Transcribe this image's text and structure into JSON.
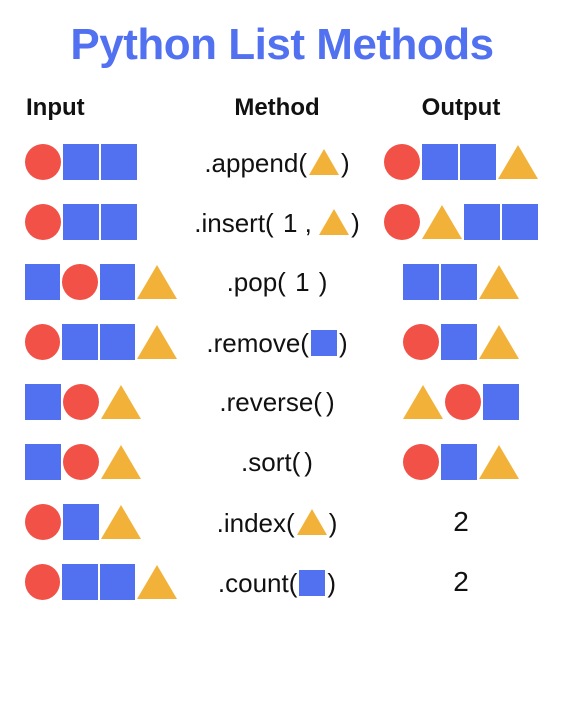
{
  "title": "Python List Methods",
  "headers": {
    "input": "Input",
    "method": "Method",
    "output": "Output"
  },
  "colors": {
    "blue": "#5171f0",
    "red": "#f15147",
    "orange": "#f2b239"
  },
  "rows": [
    {
      "input": [
        "circle",
        "square",
        "square"
      ],
      "method": {
        "name": ".append",
        "args": [
          {
            "type": "shape",
            "value": "triangle"
          }
        ]
      },
      "output": {
        "type": "shapes",
        "value": [
          "circle",
          "square",
          "square",
          "triangle"
        ]
      }
    },
    {
      "input": [
        "circle",
        "square",
        "square"
      ],
      "method": {
        "name": ".insert",
        "args": [
          {
            "type": "text",
            "value": "1"
          },
          {
            "type": "shape",
            "value": "triangle"
          }
        ]
      },
      "output": {
        "type": "shapes",
        "value": [
          "circle",
          "triangle",
          "square",
          "square"
        ]
      }
    },
    {
      "input": [
        "square",
        "circle",
        "square",
        "triangle"
      ],
      "method": {
        "name": ".pop",
        "args": [
          {
            "type": "text",
            "value": "1"
          }
        ]
      },
      "output": {
        "type": "shapes",
        "value": [
          "square",
          "square",
          "triangle"
        ]
      }
    },
    {
      "input": [
        "circle",
        "square",
        "square",
        "triangle"
      ],
      "method": {
        "name": ".remove",
        "args": [
          {
            "type": "shape",
            "value": "square"
          }
        ]
      },
      "output": {
        "type": "shapes",
        "value": [
          "circle",
          "square",
          "triangle"
        ]
      }
    },
    {
      "input": [
        "square",
        "circle",
        "triangle"
      ],
      "method": {
        "name": ".reverse",
        "args": []
      },
      "output": {
        "type": "shapes",
        "value": [
          "triangle",
          "circle",
          "square"
        ]
      }
    },
    {
      "input": [
        "square",
        "circle",
        "triangle"
      ],
      "method": {
        "name": ".sort",
        "args": []
      },
      "output": {
        "type": "shapes",
        "value": [
          "circle",
          "square",
          "triangle"
        ]
      }
    },
    {
      "input": [
        "circle",
        "square",
        "triangle"
      ],
      "method": {
        "name": ".index",
        "args": [
          {
            "type": "shape",
            "value": "triangle"
          }
        ]
      },
      "output": {
        "type": "text",
        "value": "2"
      }
    },
    {
      "input": [
        "circle",
        "square",
        "square",
        "triangle"
      ],
      "method": {
        "name": ".count",
        "args": [
          {
            "type": "shape",
            "value": "square"
          }
        ]
      },
      "output": {
        "type": "text",
        "value": "2"
      }
    }
  ]
}
